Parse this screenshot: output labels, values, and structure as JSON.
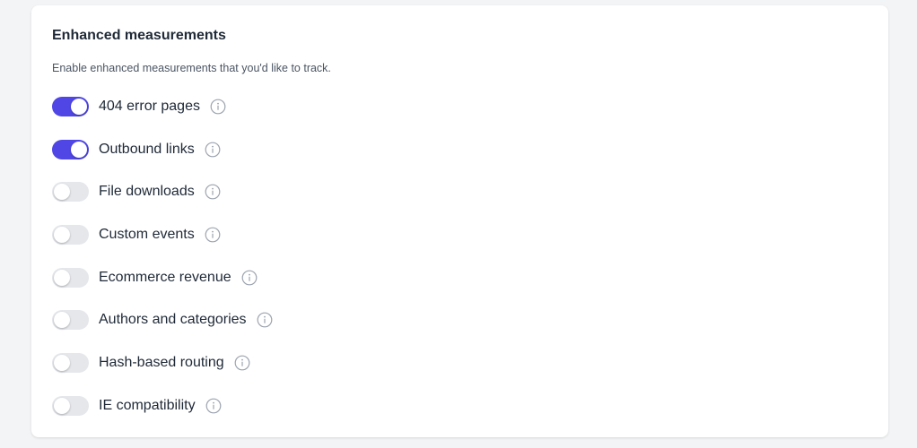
{
  "colors": {
    "accent": "#4f46e5",
    "toggle_off": "#e5e7eb"
  },
  "section": {
    "title": "Enhanced measurements",
    "description": "Enable enhanced measurements that you'd like to track."
  },
  "options": [
    {
      "label": "404 error pages",
      "enabled": true,
      "icon": "info-icon"
    },
    {
      "label": "Outbound links",
      "enabled": true,
      "icon": "info-icon"
    },
    {
      "label": "File downloads",
      "enabled": false,
      "icon": "info-icon"
    },
    {
      "label": "Custom events",
      "enabled": false,
      "icon": "info-icon"
    },
    {
      "label": "Ecommerce revenue",
      "enabled": false,
      "icon": "info-icon"
    },
    {
      "label": "Authors and categories",
      "enabled": false,
      "icon": "info-icon"
    },
    {
      "label": "Hash-based routing",
      "enabled": false,
      "icon": "info-icon"
    },
    {
      "label": "IE compatibility",
      "enabled": false,
      "icon": "info-icon"
    }
  ]
}
